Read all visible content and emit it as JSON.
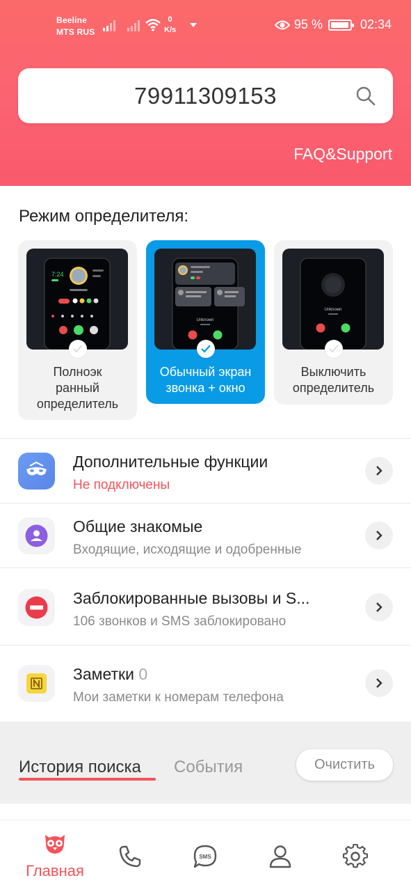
{
  "status_bar": {
    "carrier_1": "Beeline",
    "carrier_2": "MTS RUS",
    "net_speed": "0",
    "net_unit": "K/s",
    "battery": "95 %",
    "time": "02:34"
  },
  "search": {
    "value": "79911309153",
    "support_link": "FAQ&Support"
  },
  "mode": {
    "title": "Режим определителя:",
    "options": [
      {
        "label_line1": "Полноэк",
        "label_line2": "ранный",
        "label_line3": "определитель",
        "selected": false
      },
      {
        "label_line1": "Обычный экран",
        "label_line2": "звонка + окно",
        "selected": true
      },
      {
        "label_line1": "Выключить",
        "label_line2": "определитель",
        "selected": false
      }
    ],
    "preview": {
      "time": "7:24",
      "unknown": "Unknown"
    }
  },
  "menu": [
    {
      "title": "Дополнительные функции",
      "subtitle": "Не подключены",
      "icon": "mask-icon"
    },
    {
      "title": "Общие знакомые",
      "subtitle": "Входящие, исходящие и одобренные",
      "icon": "person-icon"
    },
    {
      "title": "Заблокированные вызовы и S...",
      "subtitle": "106 звонков и SMS заблокировано",
      "icon": "block-icon"
    },
    {
      "title": "Заметки",
      "count": "0",
      "subtitle": "Мои заметки к номерам телефона",
      "icon": "note-icon"
    }
  ],
  "history": {
    "tab_search": "История поиска",
    "tab_events": "События",
    "clear": "Очистить"
  },
  "nav": {
    "home": "Главная",
    "sms_icon_text": "SMS"
  },
  "colors": {
    "accent": "#f2545b",
    "header": "#fb6470",
    "selected_card": "#0a9be6"
  }
}
